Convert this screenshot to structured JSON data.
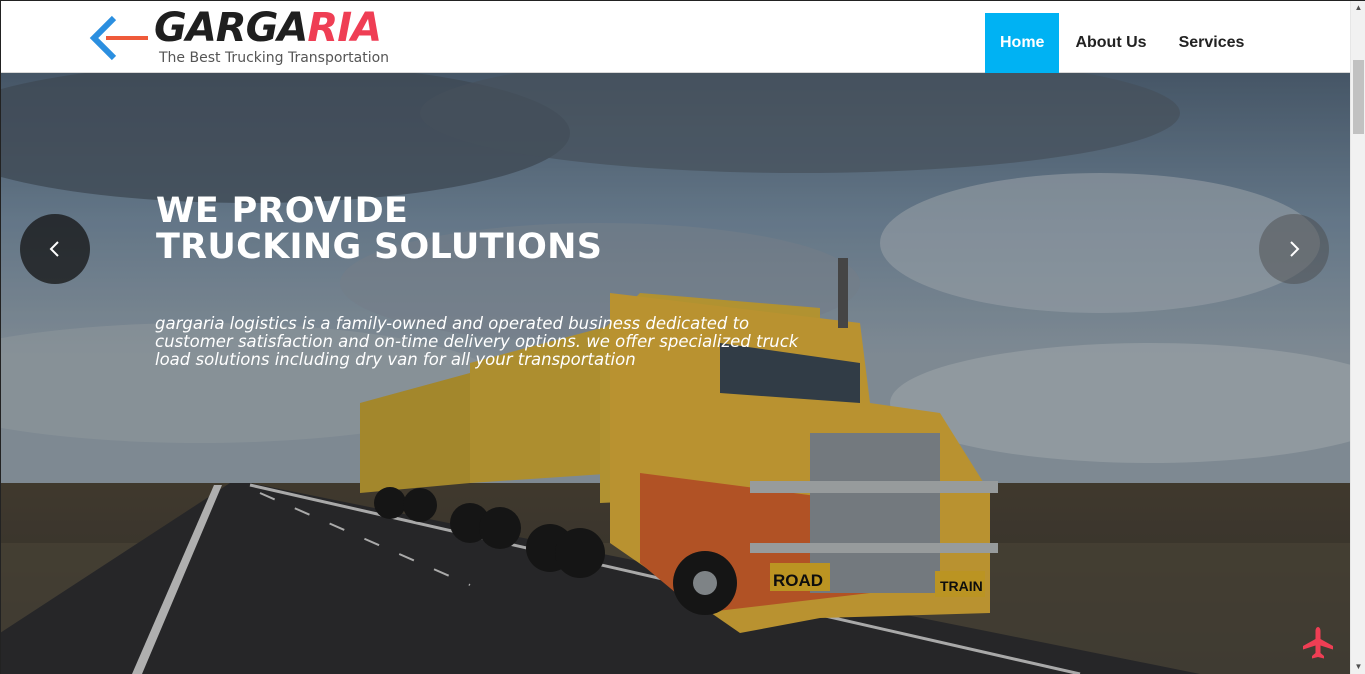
{
  "header": {
    "logo": {
      "word_dark": "GARGA",
      "word_accent": "RIA",
      "tagline": "The Best Trucking Transportation",
      "accent_color": "#ef3e54",
      "mark_color": "#2b8fe0"
    },
    "nav": [
      {
        "label": "Home",
        "active": true
      },
      {
        "label": "About Us",
        "active": false
      },
      {
        "label": "Services",
        "active": false
      }
    ],
    "nav_active_color": "#00b2f3"
  },
  "hero": {
    "title_line1": "WE PROVIDE",
    "title_line2": "TRUCKING SOLUTIONS",
    "description": "gargaria logistics is a family-owned and operated business dedicated to customer satisfaction and on-time delivery options. we offer specialized truck load solutions including dry van for all your transportation",
    "prev_icon": "chevron-left-icon",
    "next_icon": "chevron-right-icon",
    "truck_plate_text": "ROAD TRAIN"
  },
  "floating": {
    "icon": "airplane-icon",
    "color": "#ef3e54"
  }
}
